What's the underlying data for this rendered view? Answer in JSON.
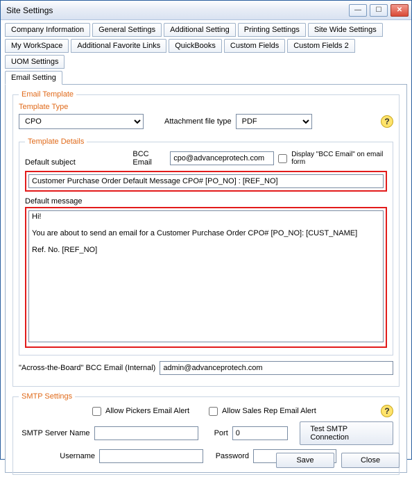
{
  "window": {
    "title": "Site Settings"
  },
  "tabs": {
    "row1": [
      "Company Information",
      "General Settings",
      "Additional Setting",
      "Printing Settings",
      "Site Wide Settings"
    ],
    "row2": [
      "My WorkSpace",
      "Additional Favorite Links",
      "QuickBooks",
      "Custom Fields",
      "Custom Fields 2",
      "UOM Settings"
    ],
    "row3": [
      "Email Setting"
    ]
  },
  "emailTemplate": {
    "legend": "Email Template",
    "templateType": {
      "legend": "Template Type",
      "value": "CPO"
    },
    "attachmentLabel": "Attachment file type",
    "attachmentValue": "PDF",
    "details": {
      "legend": "Template Details",
      "defaultSubjectLabel": "Default subject",
      "bccLabel": "BCC Email",
      "bccValue": "cpo@advanceprotech.com",
      "displayBccLabel": "Display \"BCC Email\" on email form",
      "subjectValue": "Customer Purchase Order Default Message CPO# [PO_NO] : [REF_NO]",
      "defaultMessageLabel": "Default message",
      "messageValue": "Hi!\n\nYou are about to send an email for a Customer Purchase Order CPO# [PO_NO]: [CUST_NAME]\n\nRef. No. [REF_NO]"
    },
    "acrossLabel": "\"Across-the-Board\" BCC Email (Internal)",
    "acrossValue": "admin@advanceprotech.com"
  },
  "smtp": {
    "legend": "SMTP Settings",
    "allowPickers": "Allow Pickers Email Alert",
    "allowSalesRep": "Allow Sales Rep Email Alert",
    "serverLabel": "SMTP Server Name",
    "serverValue": "",
    "portLabel": "Port",
    "portValue": "0",
    "testBtn": "Test SMTP Connection",
    "userLabel": "Username",
    "userValue": "",
    "passLabel": "Password",
    "passValue": ""
  },
  "footer": {
    "save": "Save",
    "close": "Close"
  }
}
